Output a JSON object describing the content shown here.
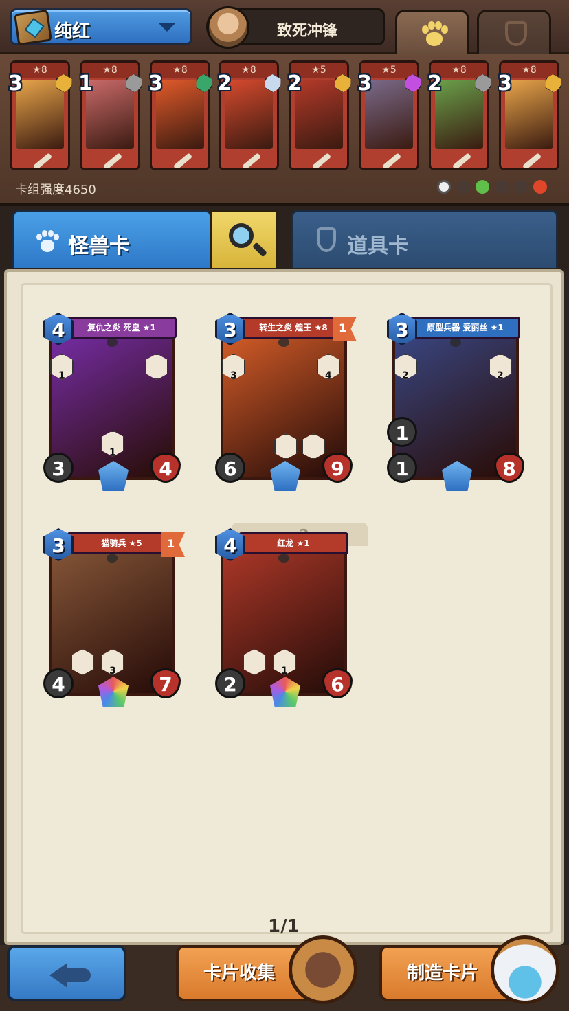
{
  "header": {
    "deck_name": "纯红",
    "hero_name": "致死冲锋"
  },
  "deck": {
    "cards": [
      {
        "stars": "★8",
        "cost": "3",
        "gem": "#e8b23a",
        "art": "#e8a54a"
      },
      {
        "stars": "★8",
        "cost": "1",
        "gem": "#9a9a9a",
        "art": "#c96a6a"
      },
      {
        "stars": "★8",
        "cost": "3",
        "gem": "#3aa76a",
        "art": "#e05a2a"
      },
      {
        "stars": "★8",
        "cost": "2",
        "gem": "#c9d9ee",
        "art": "#d64a2e"
      },
      {
        "stars": "★5",
        "cost": "2",
        "gem": "#e8b23a",
        "art": "#b43a2a"
      },
      {
        "stars": "★5",
        "cost": "3",
        "gem": "#c24fe0",
        "art": "#7a6a8a"
      },
      {
        "stars": "★8",
        "cost": "2",
        "gem": "#9a9a9a",
        "art": "#6aa04a"
      },
      {
        "stars": "★8",
        "cost": "3",
        "gem": "#e8b23a",
        "art": "#e8a54a"
      }
    ],
    "strength_label": "卡组强度4650"
  },
  "tabs": {
    "monster": "怪兽卡",
    "item": "道具卡"
  },
  "collection": {
    "cards": [
      {
        "name": "复仇之炎 死皇 ★1",
        "cost": "4",
        "atk": "3",
        "hp": "4",
        "abilities": [
          "1",
          "",
          "1"
        ],
        "flag": "",
        "art": "#7b2fb0",
        "banner": "#8a3b9e"
      },
      {
        "name": "转生之炎 煌王 ★8",
        "cost": "3",
        "atk": "6",
        "hp": "9",
        "abilities": [
          "3",
          "4",
          "",
          ""
        ],
        "flag": "1",
        "art": "#e0622a",
        "banner": "#b43a2a"
      },
      {
        "name": "原型兵器 爱丽丝 ★1",
        "cost": "3",
        "atk": "1",
        "hp": "8",
        "abilities": [
          "2",
          "2"
        ],
        "extra_atk": "1",
        "flag": "",
        "art": "#3a4a8a",
        "banner": "#2f6fc0"
      },
      {
        "name": "猫骑兵 ★5",
        "cost": "3",
        "atk": "4",
        "hp": "7",
        "abilities": [
          "",
          "3"
        ],
        "flag": "1",
        "art": "#8a5a3a",
        "banner": "#b43a2a"
      },
      {
        "name": "红龙 ★1",
        "cost": "4",
        "atk": "2",
        "hp": "6",
        "abilities": [
          "",
          "1"
        ],
        "flag": "",
        "art": "#b43a2a",
        "banner": "#b43a2a"
      }
    ],
    "duplicate_label": "x2",
    "page": "1/1"
  },
  "bottom": {
    "collect_label": "卡片收集",
    "craft_label": "制造卡片"
  }
}
